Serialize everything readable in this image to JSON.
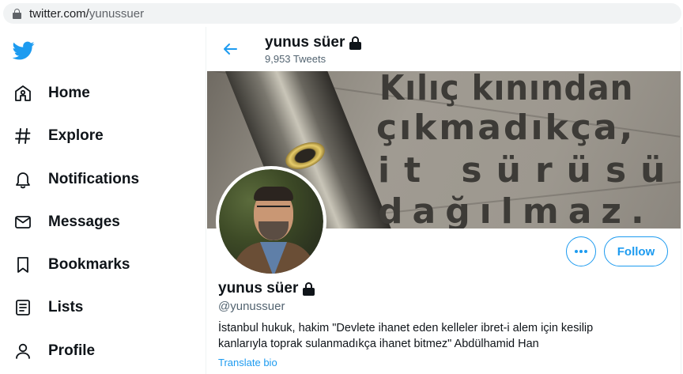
{
  "browser": {
    "url_host": "twitter.com/",
    "url_path": "yunussuer"
  },
  "sidebar": {
    "items": [
      {
        "label": "Home",
        "icon": "home-icon"
      },
      {
        "label": "Explore",
        "icon": "hashtag-icon"
      },
      {
        "label": "Notifications",
        "icon": "bell-icon"
      },
      {
        "label": "Messages",
        "icon": "envelope-icon"
      },
      {
        "label": "Bookmarks",
        "icon": "bookmark-icon"
      },
      {
        "label": "Lists",
        "icon": "list-icon"
      },
      {
        "label": "Profile",
        "icon": "person-icon"
      }
    ]
  },
  "header": {
    "name": "yunus süer",
    "tweet_count": "9,953 Tweets"
  },
  "banner": {
    "lines": [
      "Kılıç kınından",
      "çıkmadıkça,",
      "it sürüsü",
      "dağılmaz."
    ]
  },
  "profile": {
    "name": "yunus süer",
    "handle": "@yunussuer",
    "bio_line1": "İstanbul hukuk, hakim \"Devlete ihanet eden kelleler ibret-i alem için kesilip",
    "bio_line2": "kanlarıyla toprak sulanmadıkça ihanet bitmez\" Abdülhamid Han",
    "translate_label": "Translate bio",
    "follow_label": "Follow"
  },
  "colors": {
    "accent": "#1d9bf0",
    "text": "#0f1419",
    "secondary": "#536471"
  }
}
